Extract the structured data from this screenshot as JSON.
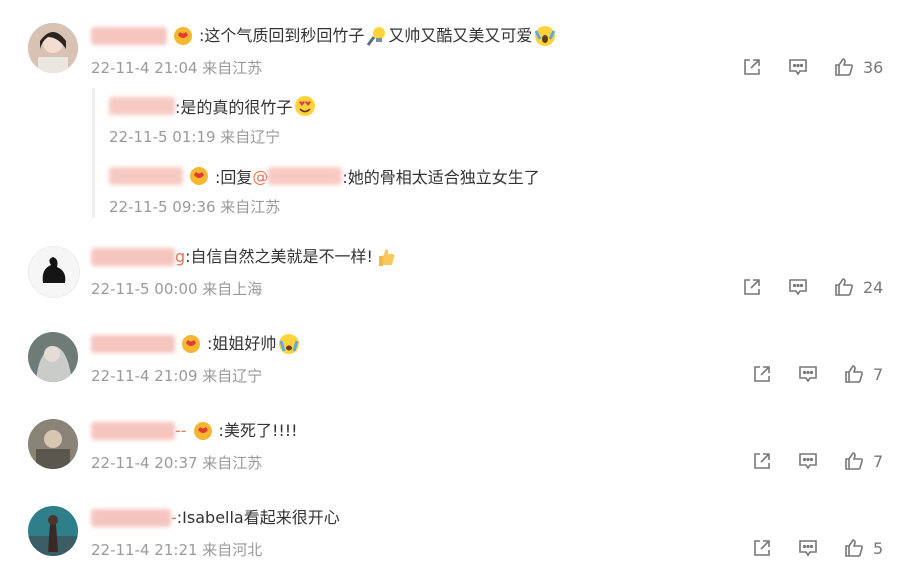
{
  "comments": [
    {
      "name_tail": "",
      "text": ":这个气质回到秒回竹子",
      "text2": "又帅又酷又美又可爱",
      "meta": "22-11-4 21:04 来自江苏",
      "likes": "36",
      "replies": [
        {
          "text": ":是的真的很竹子",
          "meta": "22-11-5 01:19 来自辽宁"
        },
        {
          "prefix": ":回复",
          "mention": "@",
          "text": ":她的骨相太适合独立女生了",
          "meta": "22-11-5 09:36 来自江苏"
        }
      ]
    },
    {
      "name_tail": "g",
      "text": ":自信自然之美就是不一样!",
      "meta": "22-11-5 00:00 来自上海",
      "likes": "24"
    },
    {
      "name_tail": "",
      "text": ":姐姐好帅",
      "meta": "22-11-4 21:09 来自辽宁",
      "likes": "7"
    },
    {
      "name_tail": "--",
      "text": ":美死了!!!!",
      "meta": "22-11-4 20:37 来自江苏",
      "likes": "7"
    },
    {
      "name_tail": "-",
      "text": ":Isabella看起来很开心",
      "meta": "22-11-4 21:21 来自河北",
      "likes": "5"
    }
  ],
  "icons": {
    "share": "share-icon",
    "comment": "comment-icon",
    "like": "like-icon",
    "badge": "vip-badge-icon"
  },
  "colors": {
    "username_blur": "#f2a9a0",
    "mention": "#eb7350",
    "meta": "#9a9a9a",
    "action": "#777777"
  }
}
